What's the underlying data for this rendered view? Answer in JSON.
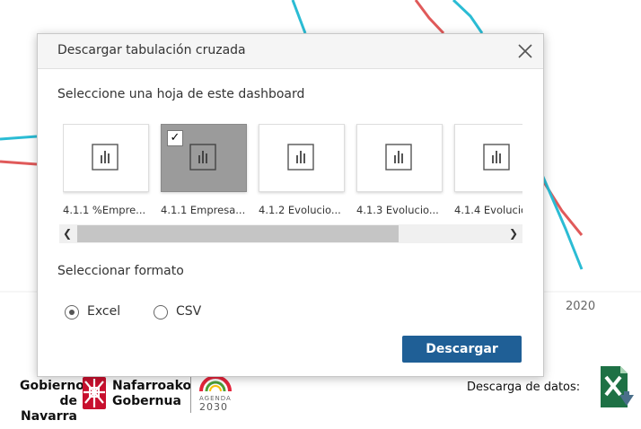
{
  "background": {
    "year_label": "2020",
    "logo_navarra_line1": "Gobierno",
    "logo_navarra_line2": "de Navarra",
    "logo_basque_line1": "Nafarroako",
    "logo_basque_line2": "Gobernua",
    "agenda_line1": "AGENDA",
    "agenda_line2": "2030",
    "download_data_label": "Descarga de datos:",
    "colors": {
      "cyan_line": "#2bbcd4",
      "red_line": "#e05a5a",
      "brand_red": "#c8102e",
      "excel_green": "#1e7145"
    }
  },
  "dialog": {
    "title": "Descargar tabulación cruzada",
    "sheet_section_label": "Seleccione una hoja de este dashboard",
    "sheets": [
      {
        "label": "4.1.1 %Empre...",
        "selected": false
      },
      {
        "label": "4.1.1 Empresa...",
        "selected": true
      },
      {
        "label": "4.1.2 Evolucio...",
        "selected": false
      },
      {
        "label": "4.1.3 Evolucio...",
        "selected": false
      },
      {
        "label": "4.1.4 Evolucio",
        "selected": false
      }
    ],
    "check_mark": "✓",
    "format_section_label": "Seleccionar formato",
    "formats": [
      {
        "label": "Excel",
        "selected": true
      },
      {
        "label": "CSV",
        "selected": false
      }
    ],
    "download_button_label": "Descargar",
    "accent_color": "#1f5f96"
  }
}
